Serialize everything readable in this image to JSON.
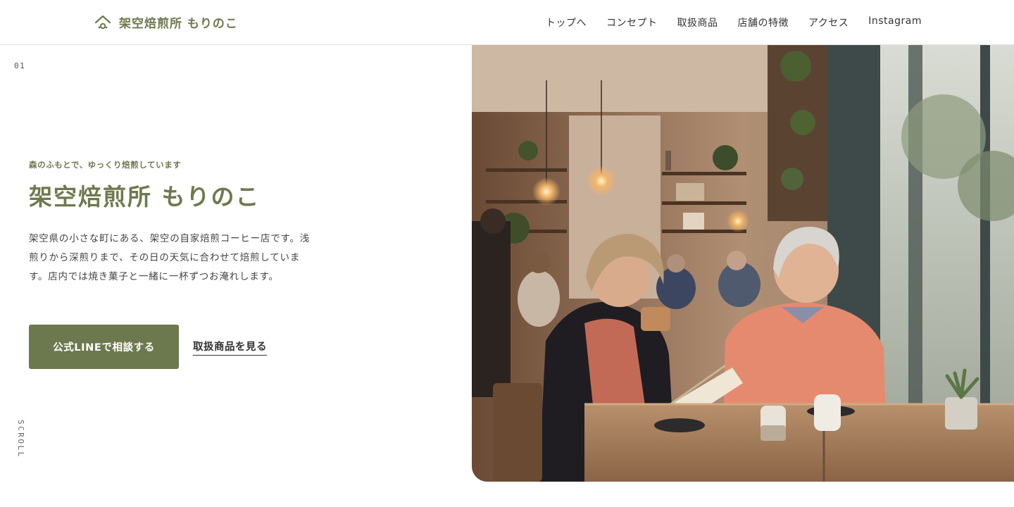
{
  "brand": {
    "name": "架空焙煎所 もりのこ",
    "color": "#6d7a4e"
  },
  "nav": {
    "items": [
      {
        "label": "トップへ"
      },
      {
        "label": "コンセプト"
      },
      {
        "label": "取扱商品"
      },
      {
        "label": "店舗の特徴"
      },
      {
        "label": "アクセス"
      },
      {
        "label": "Instagram"
      }
    ]
  },
  "hero": {
    "slide_number": "01",
    "tagline": "森のふもとで、ゆっくり焙煎しています",
    "title": "架空焙煎所 もりのこ",
    "description": "架空県の小さな町にある、架空の自家焙煎コーヒー店です。浅煎りから深煎りまで、その日の天気に合わせて焙煎しています。店内では焼き菓子と一緒に一杯ずつお淹れします。",
    "primary_button": "公式LINEで相談する",
    "secondary_link": "取扱商品を見る",
    "scroll_label": "SCROLL",
    "image_subject": "elderly couple drinking coffee in a cafe by the window"
  },
  "colors": {
    "accent": "#6d7a4e",
    "button_bg": "#6c784d",
    "button_text": "#ffffff",
    "text": "#333333",
    "border": "#e3e3e3"
  }
}
